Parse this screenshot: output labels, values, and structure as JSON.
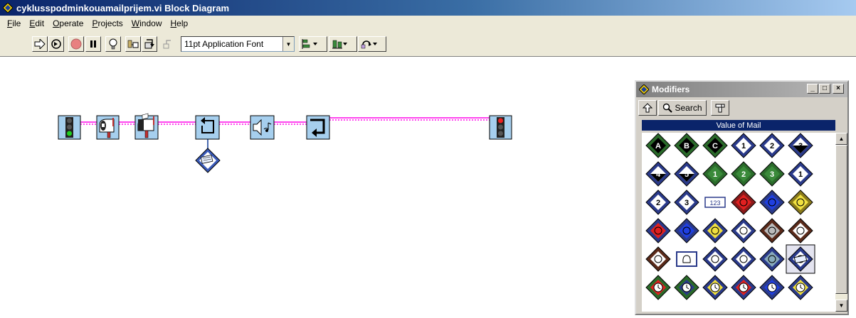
{
  "window": {
    "title": "cyklusspodminkouamailprijem.vi Block Diagram",
    "icon": "labview-diamond-icon"
  },
  "menu": [
    "File",
    "Edit",
    "Operate",
    "Projects",
    "Window",
    "Help"
  ],
  "toolbar": {
    "buttons": [
      "run-arrow-icon",
      "run-continuously-icon",
      "abort-icon",
      "pause-icon",
      "highlight-execution-icon",
      "retain-wire-values-icon",
      "step-into-icon",
      "step-over-icon",
      "step-out-icon"
    ],
    "font_select_value": "11pt Application Font",
    "dropdowns": [
      "align-objects-icon",
      "distribute-objects-icon",
      "reorder-icon"
    ]
  },
  "diagram": {
    "wire_color": "#ff44ee",
    "nodes": [
      "traffic-light-green-icon",
      "mailbox-open-icon",
      "mailbox-flag-icon",
      "loop-arrow-icon",
      "speaker-note-icon",
      "return-arrow-icon",
      "traffic-light-red-icon"
    ],
    "constant": "mail-letter-diamond-icon"
  },
  "palette": {
    "title": "Modifiers",
    "up_button": "up-arrow-icon",
    "search_label": "Search",
    "options_button": "palette-options-icon",
    "heading": "Value of Mail",
    "window_buttons": [
      "_",
      "□",
      "×"
    ],
    "rows": [
      [
        "A",
        "B",
        "C",
        "1",
        "2",
        "3"
      ],
      [
        "4",
        "5",
        "1",
        "2",
        "3",
        "1"
      ],
      [
        "2",
        "3",
        "123",
        "",
        "",
        ""
      ],
      [
        "",
        "",
        "",
        "",
        "",
        ""
      ],
      [
        "",
        "",
        "",
        "",
        "",
        ""
      ],
      [
        "",
        "",
        "",
        "",
        "",
        ""
      ]
    ]
  }
}
